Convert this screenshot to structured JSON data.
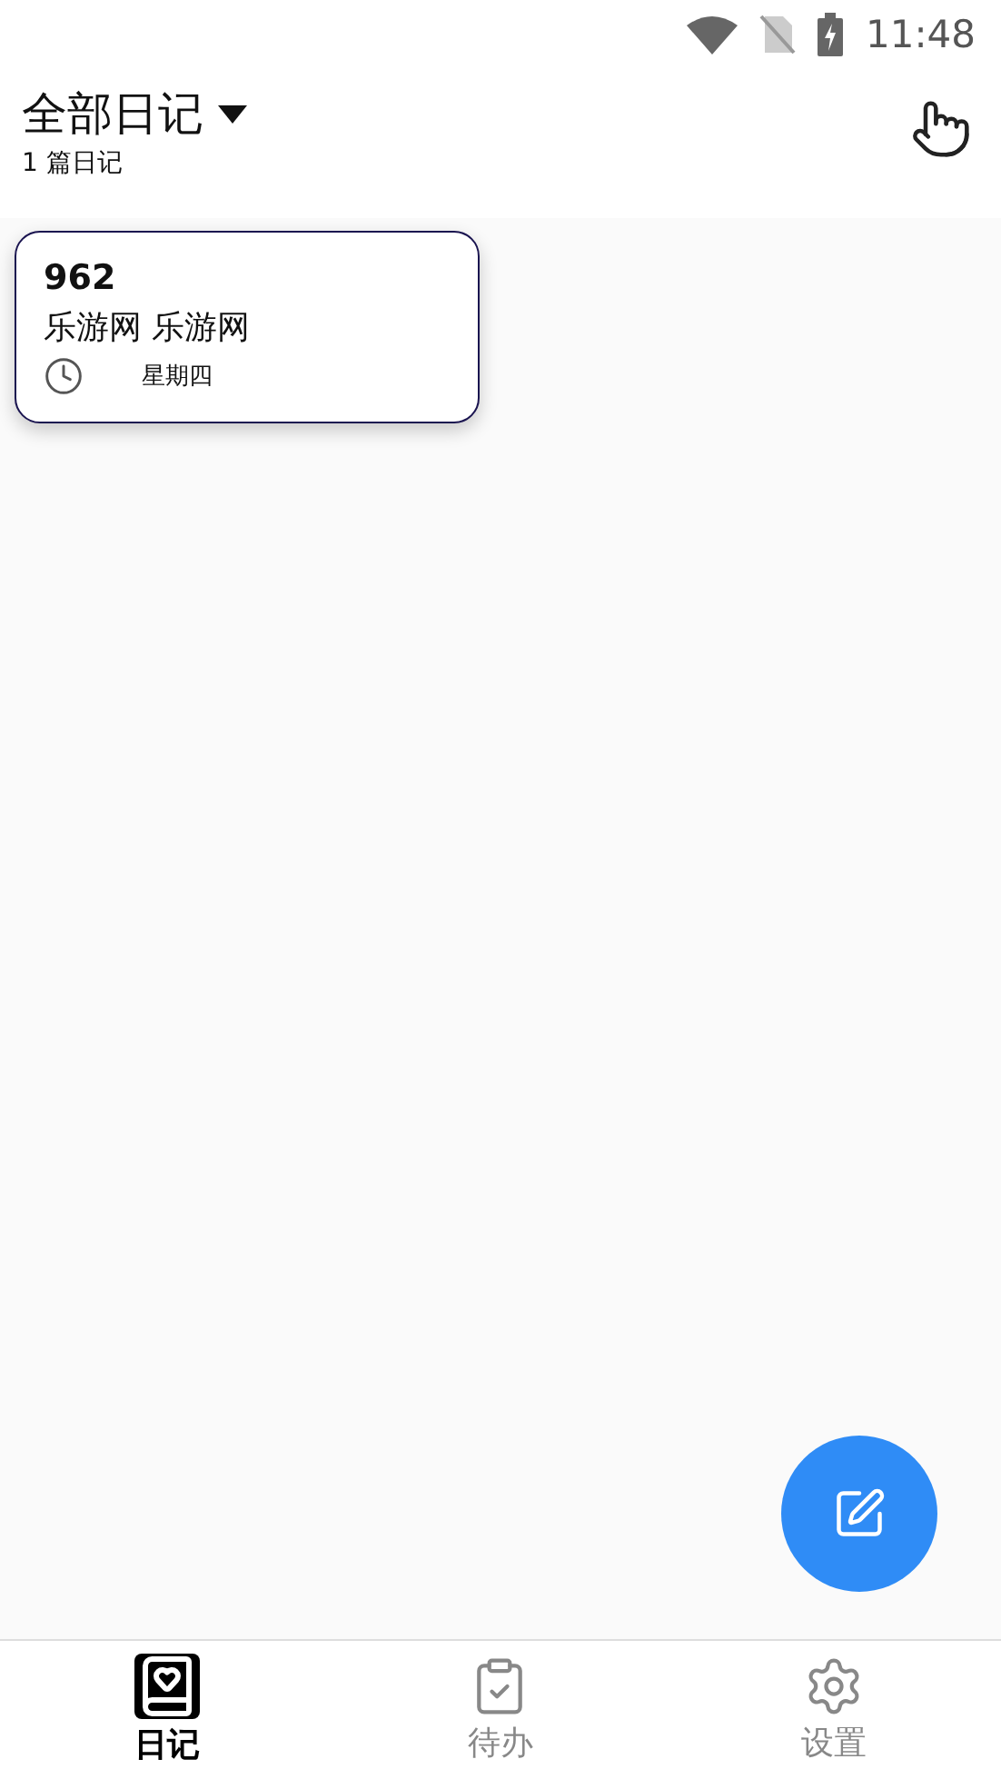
{
  "status_bar": {
    "time": "11:48"
  },
  "header": {
    "title": "全部日记",
    "subtitle": "1 篇日记"
  },
  "entries": [
    {
      "title": "962",
      "body": "乐游网 乐游网",
      "weekday": "星期四"
    }
  ],
  "tabs": [
    {
      "label": "日记",
      "selected": true,
      "kind": "diary"
    },
    {
      "label": "待办",
      "selected": false,
      "kind": "todo"
    },
    {
      "label": "设置",
      "selected": false,
      "kind": "settings"
    }
  ]
}
